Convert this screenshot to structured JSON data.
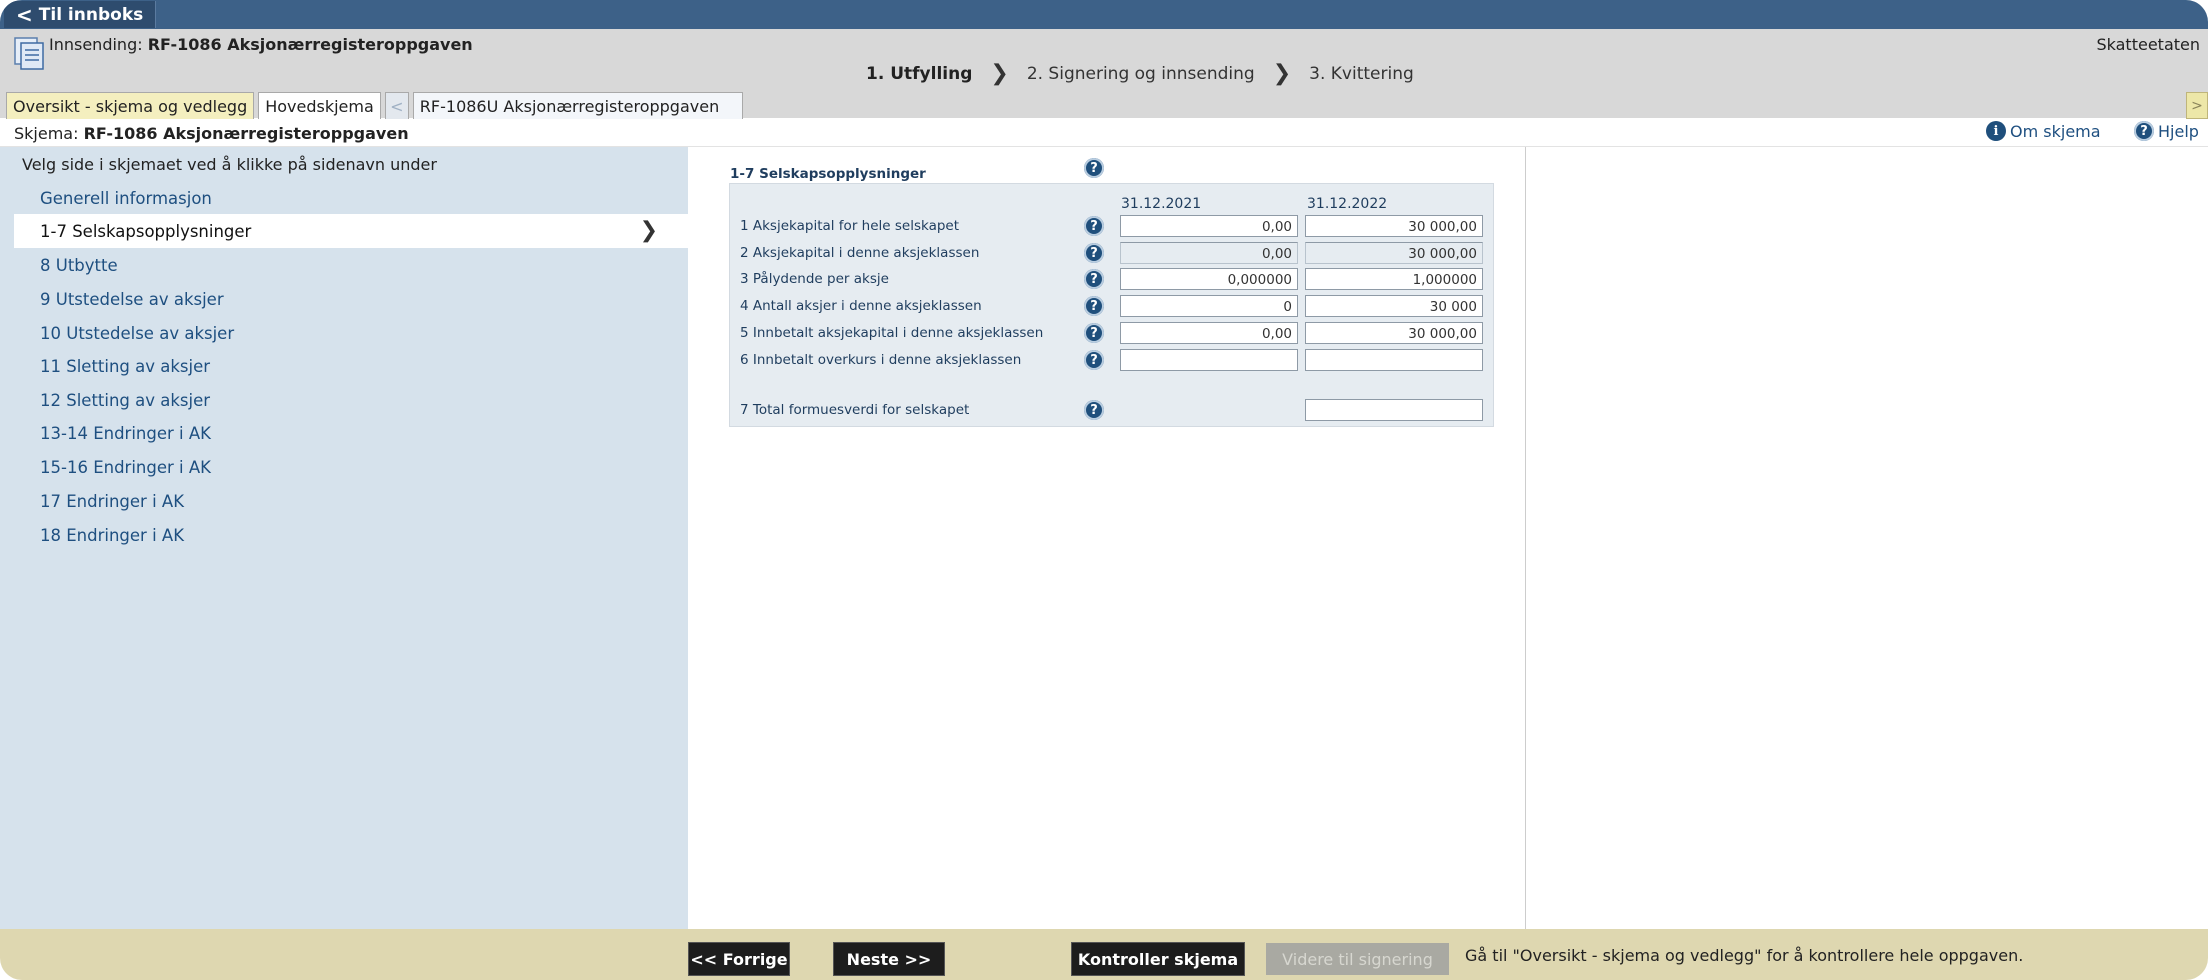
{
  "topbar": {
    "back_label": "Til innboks"
  },
  "header": {
    "innsending_prefix": "Innsending:",
    "innsending_title": "RF-1086 Aksjonærregisteroppgaven",
    "agency": "Skatteetaten",
    "steps": [
      {
        "label": "1. Utfylling",
        "active": true
      },
      {
        "label": "2. Signering og innsending",
        "active": false
      },
      {
        "label": "3. Kvittering",
        "active": false
      }
    ]
  },
  "tabs": {
    "overview": "Oversikt - skjema og vedlegg",
    "main": "Hovedskjema",
    "prev_arrow": "<",
    "sub": "RF-1086U Aksjonærregisteroppgaven",
    "next_arrow": ">"
  },
  "schema": {
    "prefix": "Skjema:",
    "title": "RF-1086 Aksjonærregisteroppgaven",
    "about_label": "Om skjema",
    "help_label": "Hjelp"
  },
  "nav": {
    "hint": "Velg side i skjemaet ved å klikke på sidenavn under",
    "items": [
      {
        "label": "Generell informasjon",
        "active": false
      },
      {
        "label": "1-7 Selskapsopplysninger",
        "active": true
      },
      {
        "label": "8 Utbytte",
        "active": false
      },
      {
        "label": "9 Utstedelse av aksjer",
        "active": false
      },
      {
        "label": "10 Utstedelse av aksjer",
        "active": false
      },
      {
        "label": "11 Sletting av aksjer",
        "active": false
      },
      {
        "label": "12 Sletting av aksjer",
        "active": false
      },
      {
        "label": "13-14 Endringer i AK",
        "active": false
      },
      {
        "label": "15-16 Endringer i AK",
        "active": false
      },
      {
        "label": "17 Endringer i AK",
        "active": false
      },
      {
        "label": "18 Endringer i AK",
        "active": false
      }
    ]
  },
  "form": {
    "section_title": "1-7 Selskapsopplysninger",
    "col1": "31.12.2021",
    "col2": "31.12.2022",
    "rows": [
      {
        "label": "1 Aksjekapital for hele selskapet",
        "v1": "0,00",
        "v2": "30 000,00",
        "readonly": false
      },
      {
        "label": "2 Aksjekapital i denne aksjeklassen",
        "v1": "0,00",
        "v2": "30 000,00",
        "readonly": true
      },
      {
        "label": "3 Pålydende per aksje",
        "v1": "0,000000",
        "v2": "1,000000",
        "readonly": false
      },
      {
        "label": "4 Antall aksjer i denne aksjeklassen",
        "v1": "0",
        "v2": "30 000",
        "readonly": false
      },
      {
        "label": "5 Innbetalt aksjekapital i denne aksjeklassen",
        "v1": "0,00",
        "v2": "30 000,00",
        "readonly": false
      },
      {
        "label": "6 Innbetalt overkurs i denne aksjeklassen",
        "v1": "",
        "v2": "",
        "readonly": false
      }
    ],
    "total_label": "7 Total formuesverdi for selskapet",
    "total_value": ""
  },
  "footer": {
    "prev": "<< Forrige",
    "next": "Neste >>",
    "check": "Kontroller skjema",
    "proceed": "Videre til signering",
    "message": "Gå til \"Oversikt - skjema og vedlegg\" for å kontrollere hele oppgaven."
  }
}
